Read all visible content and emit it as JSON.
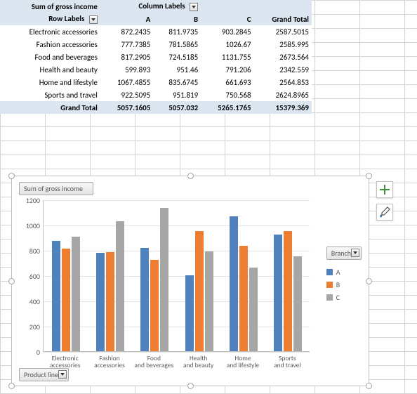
{
  "pivot": {
    "value_field_label": "Sum of gross income",
    "column_field_label": "Column Labels",
    "row_field_label": "Row Labels",
    "grand_total_label": "Grand Total",
    "columns": [
      "A",
      "B",
      "C"
    ],
    "rows": [
      {
        "label": "Electronic accessories",
        "vals": [
          "872.2435",
          "811.9735",
          "903.2845"
        ],
        "total": "2587.5015"
      },
      {
        "label": "Fashion accessories",
        "vals": [
          "777.7385",
          "781.5865",
          "1026.67"
        ],
        "total": "2585.995"
      },
      {
        "label": "Food and beverages",
        "vals": [
          "817.2905",
          "724.5185",
          "1131.755"
        ],
        "total": "2673.564"
      },
      {
        "label": "Health and beauty",
        "vals": [
          "599.893",
          "951.46",
          "791.206"
        ],
        "total": "2342.559"
      },
      {
        "label": "Home and lifestyle",
        "vals": [
          "1067.4855",
          "835.6745",
          "661.693"
        ],
        "total": "2564.853"
      },
      {
        "label": "Sports and travel",
        "vals": [
          "922.5095",
          "951.819",
          "750.568"
        ],
        "total": "2624.8965"
      }
    ],
    "col_totals": [
      "5057.1605",
      "5057.032",
      "5265.1765"
    ],
    "grand_total": "15379.369"
  },
  "chart_chip_value": "Sum of gross income",
  "chart_chip_legend": "Branch",
  "chart_chip_axis": "Product line",
  "side_buttons": {
    "add": "plus-icon",
    "style": "brush-icon"
  },
  "chart_data": {
    "type": "bar",
    "title": "Sum of gross income",
    "categories": [
      "Electronic accessories",
      "Fashion accessories",
      "Food and beverages",
      "Health and beauty",
      "Home and lifestyle",
      "Sports and travel"
    ],
    "series": [
      {
        "name": "A",
        "color": "#4f81bd",
        "values": [
          872.2435,
          777.7385,
          817.2905,
          599.893,
          1067.4855,
          922.5095
        ]
      },
      {
        "name": "B",
        "color": "#ed7d31",
        "values": [
          811.9735,
          781.5865,
          724.5185,
          951.46,
          835.6745,
          951.819
        ]
      },
      {
        "name": "C",
        "color": "#a6a6a6",
        "values": [
          903.2845,
          1026.67,
          1131.755,
          791.206,
          661.693,
          750.568
        ]
      }
    ],
    "xlabel": "Product line",
    "ylabel": "",
    "ylim": [
      0,
      1200
    ],
    "yticks": [
      0,
      200,
      400,
      600,
      800,
      1000,
      1200
    ],
    "legend_title": "Branch"
  }
}
